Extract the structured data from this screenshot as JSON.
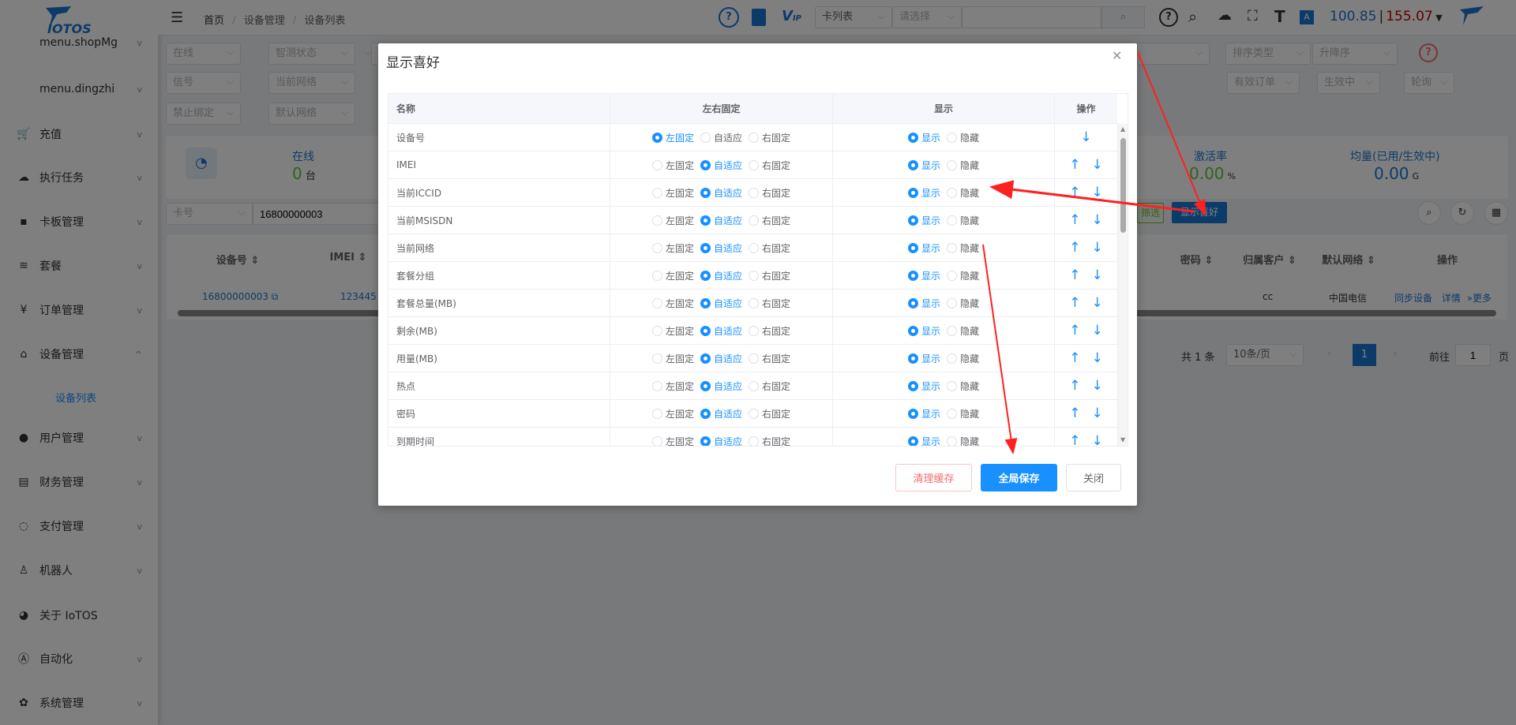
{
  "brand": {
    "logo_text": "IOTOS"
  },
  "sidebar": {
    "items": [
      {
        "label": "menu.shopMg",
        "icon": "none"
      },
      {
        "label": "menu.dingzhi",
        "icon": "none"
      },
      {
        "label": "充值",
        "icon": "cart-icon"
      },
      {
        "label": "执行任务",
        "icon": "cloud-icon"
      },
      {
        "label": "卡板管理",
        "icon": "card-icon"
      },
      {
        "label": "套餐",
        "icon": "layers-icon"
      },
      {
        "label": "订单管理",
        "icon": "yen-icon"
      },
      {
        "label": "设备管理",
        "icon": "device-icon"
      },
      {
        "label": "用户管理",
        "icon": "user-icon"
      },
      {
        "label": "财务管理",
        "icon": "finance-icon"
      },
      {
        "label": "支付管理",
        "icon": "shield-icon"
      },
      {
        "label": "机器人",
        "icon": "robot-icon"
      },
      {
        "label": "关于 IoTOS",
        "icon": "globe-icon"
      },
      {
        "label": "自动化",
        "icon": "automation-icon"
      },
      {
        "label": "系统管理",
        "icon": "gear-icon"
      }
    ],
    "active_sub": "设备列表"
  },
  "header": {
    "breadcrumb": [
      "首页",
      "设备管理",
      "设备列表"
    ],
    "search_type": "卡列表",
    "search_select": "请选择",
    "search_value": "",
    "balance_blue": "100.85",
    "balance_red": "155.07",
    "separator": "|"
  },
  "filters": {
    "row1": [
      "在线",
      "智测状态",
      "",
      "排序类型",
      "升降序"
    ],
    "row2": [
      "信号",
      "当前网络",
      "有效订单",
      "生效中",
      "轮询"
    ],
    "row3": [
      "禁止绑定",
      "默认网络"
    ],
    "search_field": "卡号",
    "search_value": "16800000003"
  },
  "stats": {
    "online_label": "在线",
    "online_value": "0",
    "online_unit": "台",
    "rate_label": "激活率",
    "rate_value": "0.00",
    "rate_unit": "%",
    "avg_label": "均量(已用/生效中)",
    "avg_value": "0.00",
    "avg_unit": "G"
  },
  "actions": {
    "filter": "筛选",
    "display_pref": "显示喜好"
  },
  "table": {
    "headers_left": [
      "设备号",
      "IMEI"
    ],
    "headers_right": [
      "密码",
      "归属客户",
      "默认网络",
      "操作"
    ],
    "row": {
      "device": "16800000003",
      "imei": "123445",
      "customer": "cc",
      "network": "中国电信",
      "sync": "同步设备",
      "detail": "详情",
      "more": "更多"
    }
  },
  "pagination": {
    "total": "共 1 条",
    "page_size": "10条/页",
    "current": "1",
    "goto": "前往",
    "goto_value": "1",
    "page_suffix": "页"
  },
  "modal": {
    "title": "显示喜好",
    "headers": [
      "名称",
      "左右固定",
      "显示",
      "操作"
    ],
    "fix_options": [
      "左固定",
      "自适应",
      "右固定"
    ],
    "show_options": [
      "显示",
      "隐藏"
    ],
    "rows": [
      {
        "name": "设备号",
        "fix": "左固定",
        "show": "显示"
      },
      {
        "name": "IMEI",
        "fix": "自适应",
        "show": "显示"
      },
      {
        "name": "当前ICCID",
        "fix": "自适应",
        "show": "显示"
      },
      {
        "name": "当前MSISDN",
        "fix": "自适应",
        "show": "显示"
      },
      {
        "name": "当前网络",
        "fix": "自适应",
        "show": "显示"
      },
      {
        "name": "套餐分组",
        "fix": "自适应",
        "show": "显示"
      },
      {
        "name": "套餐总量(MB)",
        "fix": "自适应",
        "show": "显示"
      },
      {
        "name": "剩余(MB)",
        "fix": "自适应",
        "show": "显示"
      },
      {
        "name": "用量(MB)",
        "fix": "自适应",
        "show": "显示"
      },
      {
        "name": "热点",
        "fix": "自适应",
        "show": "显示"
      },
      {
        "name": "密码",
        "fix": "自适应",
        "show": "显示"
      },
      {
        "name": "到期时间",
        "fix": "自适应",
        "show": "显示"
      }
    ],
    "buttons": {
      "clear": "清理缓存",
      "save": "全局保存",
      "close": "关闭"
    }
  },
  "colors": {
    "primary": "#1890ff",
    "danger": "#f56c6c",
    "online_green": "#67c23a",
    "balance_red": "#c00000",
    "annotation_red": "#ff2020"
  }
}
